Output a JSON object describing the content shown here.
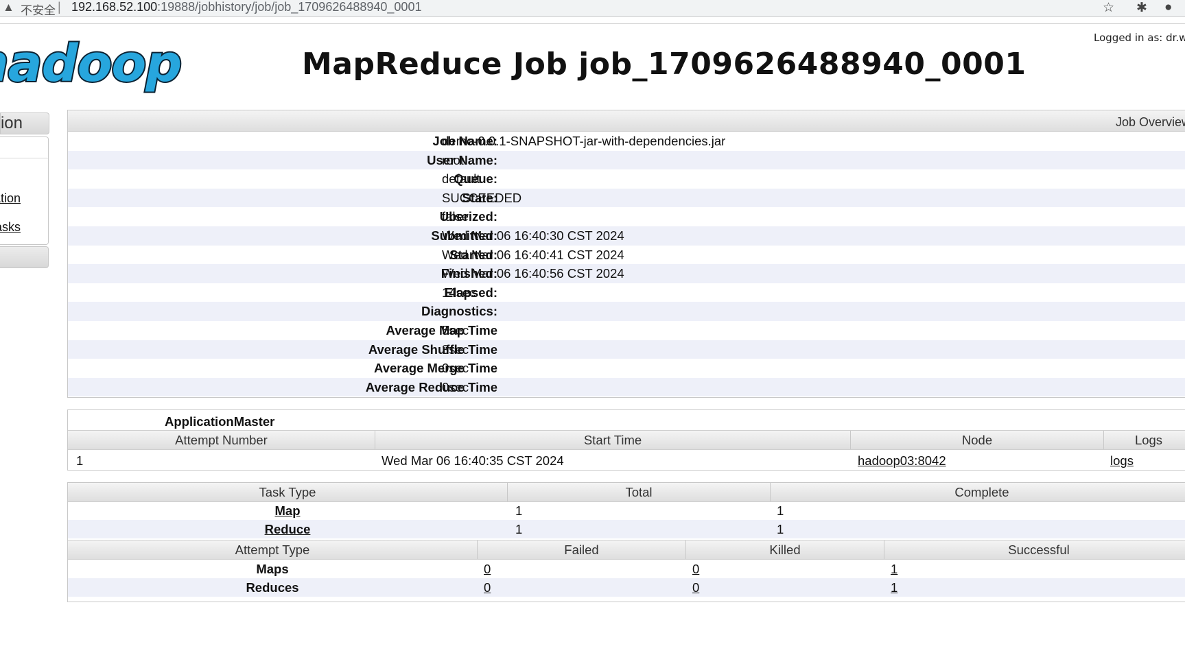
{
  "browser": {
    "warning_icon": "warning-triangle-icon",
    "security_label": "不安全",
    "separator": "|",
    "url_host": "192.168.52.100",
    "url_path": ":19888/jobhistory/job/job_1709626488940_0001",
    "star_icon": "star-icon",
    "extensions_icon": "puzzle-icon",
    "profile_icon": "person-icon"
  },
  "header": {
    "logo_text": "hadoop",
    "title": "MapReduce Job job_1709626488940_0001",
    "logged_in": "Logged in as: dr.w"
  },
  "nav": {
    "section_label": "Application",
    "links": [
      "Configuration",
      "Map tasks"
    ]
  },
  "overview": {
    "header": "Job Overview",
    "rows": [
      {
        "label": "Job Name:",
        "value": "demo-0.0.1-SNAPSHOT-jar-with-dependencies.jar"
      },
      {
        "label": "User Name:",
        "value": "root"
      },
      {
        "label": "Queue:",
        "value": "default"
      },
      {
        "label": "State:",
        "value": "SUCCEEDED"
      },
      {
        "label": "Uberized:",
        "value": "false"
      },
      {
        "label": "Submitted:",
        "value": "Wed Mar 06 16:40:30 CST 2024"
      },
      {
        "label": "Started:",
        "value": "Wed Mar 06 16:40:41 CST 2024"
      },
      {
        "label": "Finished:",
        "value": "Wed Mar 06 16:40:56 CST 2024"
      },
      {
        "label": "Elapsed:",
        "value": "14sec"
      },
      {
        "label": "Diagnostics:",
        "value": ""
      },
      {
        "label": "Average Map Time",
        "value": "5sec"
      },
      {
        "label": "Average Shuffle Time",
        "value": "3sec"
      },
      {
        "label": "Average Merge Time",
        "value": "0sec"
      },
      {
        "label": "Average Reduce Time",
        "value": "0sec"
      }
    ]
  },
  "app_master": {
    "title": "ApplicationMaster",
    "columns": [
      "Attempt Number",
      "Start Time",
      "Node",
      "Logs"
    ],
    "row": {
      "attempt": "1",
      "start_time": "Wed Mar 06 16:40:35 CST 2024",
      "node": "hadoop03:8042",
      "logs": "logs"
    }
  },
  "tasks": {
    "columns": [
      "Task Type",
      "Total",
      "Complete"
    ],
    "rows": [
      {
        "type": "Map",
        "total": "1",
        "complete": "1"
      },
      {
        "type": "Reduce",
        "total": "1",
        "complete": "1"
      }
    ],
    "attempt_columns": [
      "Attempt Type",
      "Failed",
      "Killed",
      "Successful"
    ],
    "attempt_rows": [
      {
        "type": "Maps",
        "failed": "0",
        "killed": "0",
        "successful": "1"
      },
      {
        "type": "Reduces",
        "failed": "0",
        "killed": "0",
        "successful": "1"
      }
    ]
  }
}
